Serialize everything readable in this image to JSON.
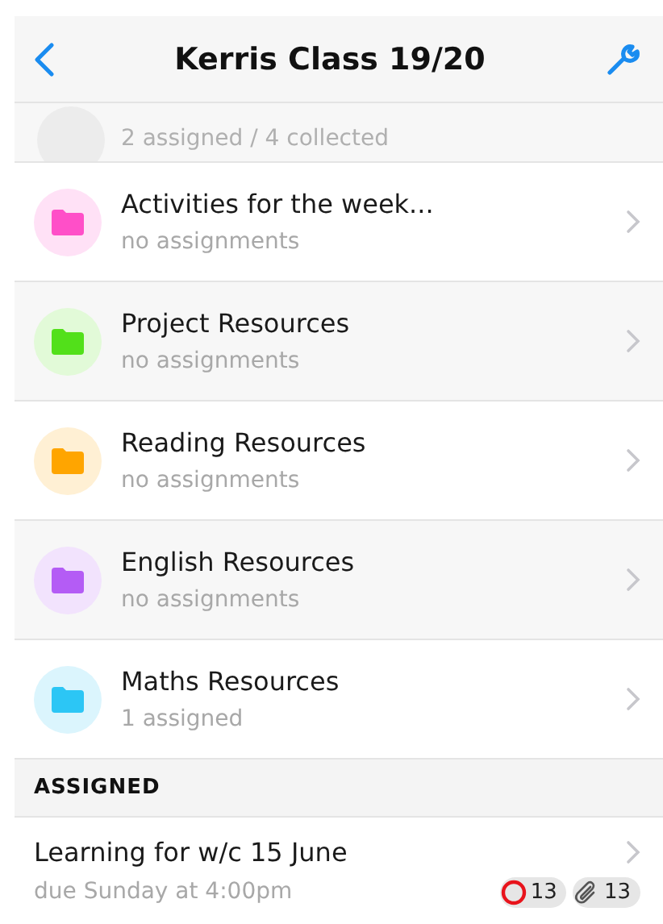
{
  "nav": {
    "title": "Kerris Class 19/20"
  },
  "partial_row": {
    "subtitle": "2 assigned / 4 collected"
  },
  "folders": [
    {
      "title": "Activities for the week...",
      "subtitle": "no assignments",
      "color": "#ff4fc8"
    },
    {
      "title": "Project Resources",
      "subtitle": "no assignments",
      "color": "#52e01a"
    },
    {
      "title": "Reading Resources",
      "subtitle": "no assignments",
      "color": "#ffa500"
    },
    {
      "title": "English Resources",
      "subtitle": "no assignments",
      "color": "#b45cf5"
    },
    {
      "title": "Maths Resources",
      "subtitle": "1 assigned",
      "color": "#2cc6f5"
    }
  ],
  "section_header": "ASSIGNED",
  "assignments": [
    {
      "title": "Learning for w/c 15 June",
      "due": "due Sunday at 4:00pm",
      "pending_count": "13",
      "attachment_count": "13"
    }
  ]
}
